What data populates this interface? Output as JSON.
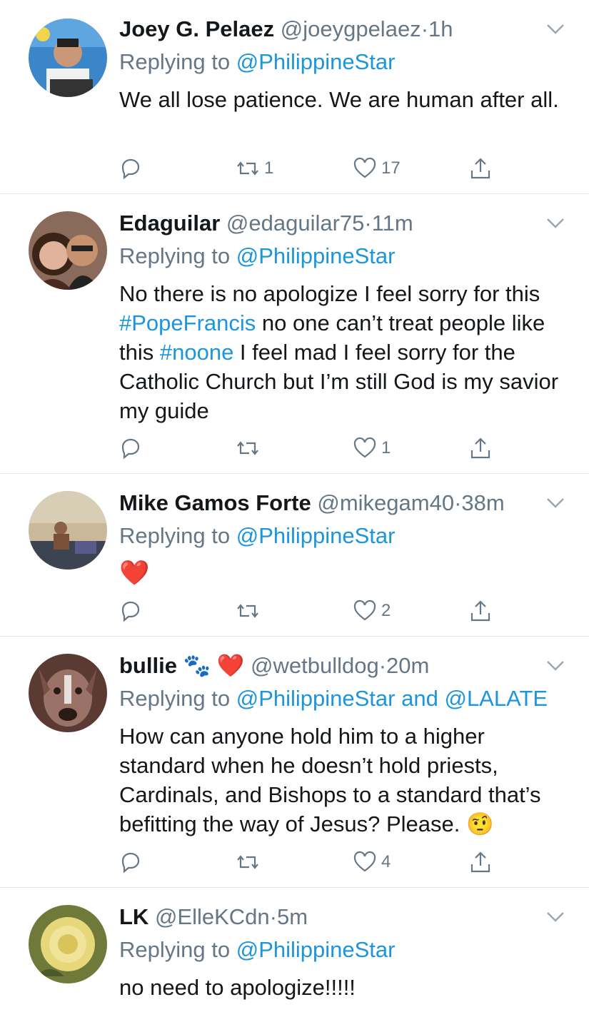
{
  "tweets": [
    {
      "name": "Joey G. Pelaez",
      "handle": "@joeygpelaez",
      "time": "1h",
      "replying_prefix": "Replying to",
      "replying_to": "@PhilippineStar",
      "text": "We all lose patience. We are human after all.",
      "replies": "",
      "retweets": "1",
      "likes": "17"
    },
    {
      "name": "Edaguilar",
      "handle": "@edaguilar75",
      "time": "11m",
      "replying_prefix": "Replying to",
      "replying_to": "@PhilippineStar",
      "text_parts": [
        "No there is no apologize I feel sorry for this ",
        "#PopeFrancis",
        " no one can’t treat people like this ",
        "#noone",
        " I feel mad I feel sorry for the Catholic Church but I’m still God is my savior my guide"
      ],
      "replies": "",
      "retweets": "",
      "likes": "1"
    },
    {
      "name": "Mike Gamos Forte",
      "handle": "@mikegam40",
      "time": "38m",
      "replying_prefix": "Replying to",
      "replying_to": "@PhilippineStar",
      "text": "❤️",
      "replies": "",
      "retweets": "",
      "likes": "2"
    },
    {
      "name": "bullie",
      "name_emojis": "🐾 ❤️",
      "handle": "@wetbulldog",
      "time": "20m",
      "replying_prefix": "Replying to",
      "replying_to": "@PhilippineStar",
      "replying_joiner": "and",
      "replying_to_2": "@LALATE",
      "text": "How can anyone hold him to a higher standard when he doesn’t hold priests, Cardinals, and Bishops to a standard that’s befitting the way of Jesus? Please. 🤨",
      "replies": "",
      "retweets": "",
      "likes": "4"
    },
    {
      "name": "LK",
      "handle": "@ElleKCdn",
      "time": "5m",
      "replying_prefix": "Replying to",
      "replying_to": "@PhilippineStar",
      "text": "no need to apologize!!!!!"
    }
  ],
  "separator": "·",
  "colors": {
    "link": "#1b95e0",
    "secondary": "#657786",
    "divider": "#e1e8ed",
    "text": "#14171a"
  },
  "icons": [
    "reply-icon",
    "retweet-icon",
    "like-icon",
    "share-icon",
    "chevron-down-icon"
  ]
}
